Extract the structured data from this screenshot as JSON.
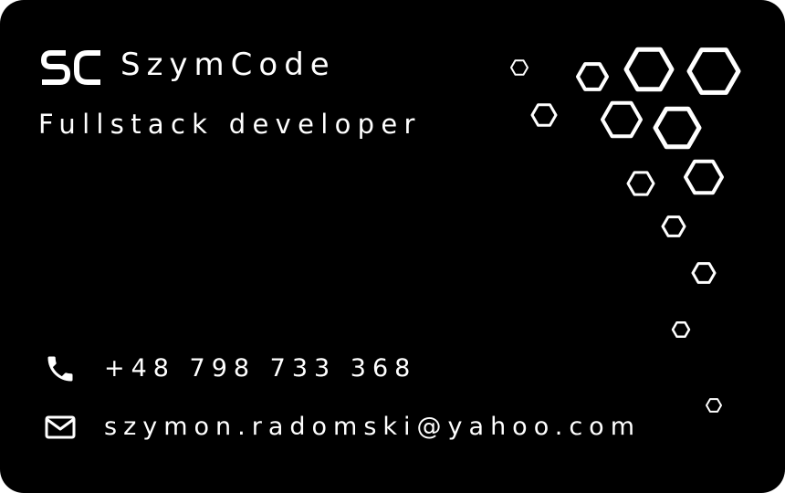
{
  "card": {
    "background": "#000000",
    "foreground": "#ffffff",
    "logo_letters": "SC",
    "brand_name": "SzymCode",
    "job_title": "Fullstack developer",
    "phone": {
      "icon": "phone-icon",
      "text": "+48 798 733 368"
    },
    "email": {
      "icon": "envelope-icon",
      "text": "szymon.radomski@yahoo.com"
    },
    "decoration": {
      "icon": "hexagon-icon"
    }
  }
}
